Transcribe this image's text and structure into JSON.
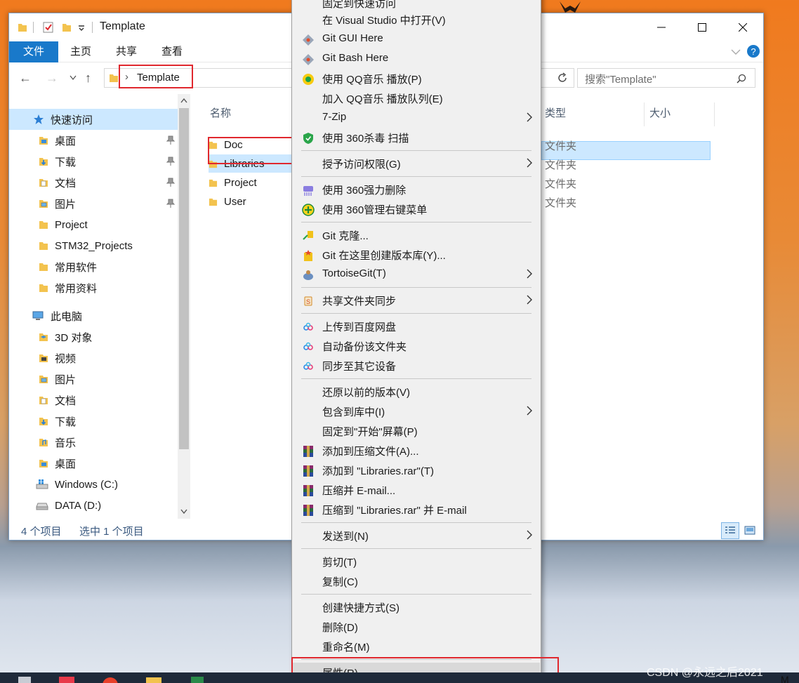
{
  "window": {
    "title": "Template",
    "ribbon_tabs": [
      "文件",
      "主页",
      "共享",
      "查看"
    ],
    "address": "Template",
    "search_placeholder": "搜索\"Template\""
  },
  "nav": {
    "quick_access": "快速访问",
    "quick_items": [
      "桌面",
      "下载",
      "文档",
      "图片",
      "Project",
      "STM32_Projects",
      "常用软件",
      "常用资料"
    ],
    "this_pc": "此电脑",
    "pc_items": [
      "3D 对象",
      "视频",
      "图片",
      "文档",
      "下载",
      "音乐",
      "桌面",
      "Windows (C:)",
      "DATA (D:)"
    ]
  },
  "content": {
    "col_name": "名称",
    "col_type": "类型",
    "col_size": "大小",
    "files": [
      {
        "name": "Doc",
        "type": "文件夹"
      },
      {
        "name": "Libraries",
        "type": "文件夹"
      },
      {
        "name": "Project",
        "type": "文件夹"
      },
      {
        "name": "User",
        "type": "文件夹"
      }
    ]
  },
  "status": {
    "count": "4 个项目",
    "selected": "选中 1 个项目"
  },
  "menu": {
    "items": [
      "固定到快速访问",
      "在 Visual Studio 中打开(V)",
      "Git GUI Here",
      "Git Bash Here",
      "使用 QQ音乐 播放(P)",
      "加入 QQ音乐 播放队列(E)",
      "7-Zip",
      "使用 360杀毒 扫描",
      "授予访问权限(G)",
      "使用 360强力删除",
      "使用 360管理右键菜单",
      "Git 克隆...",
      "Git 在这里创建版本库(Y)...",
      "TortoiseGit(T)",
      "共享文件夹同步",
      "上传到百度网盘",
      "自动备份该文件夹",
      "同步至其它设备",
      "还原以前的版本(V)",
      "包含到库中(I)",
      "固定到\"开始\"屏幕(P)",
      "添加到压缩文件(A)...",
      "添加到 \"Libraries.rar\"(T)",
      "压缩并 E-mail...",
      "压缩到 \"Libraries.rar\" 并 E-mail",
      "发送到(N)",
      "剪切(T)",
      "复制(C)",
      "创建快捷方式(S)",
      "删除(D)",
      "重命名(M)",
      "属性(R)"
    ]
  },
  "watermark": "CSDN @永远之后2021",
  "corner_text": "M"
}
